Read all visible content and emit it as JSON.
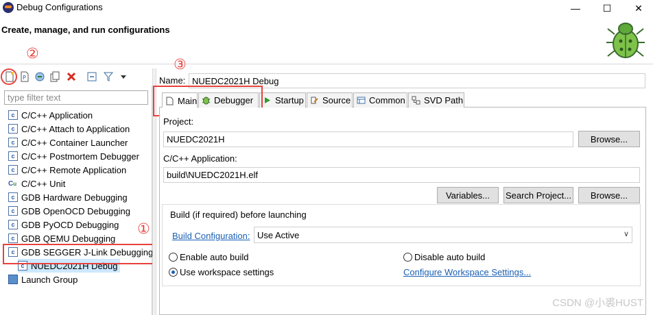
{
  "window": {
    "title": "Debug Configurations",
    "minimize": "—",
    "maximize": "☐",
    "close": "✕"
  },
  "header": {
    "title": "Create, manage, and run configurations",
    "logo_icon": "bug-icon"
  },
  "annotations": {
    "one": "①",
    "two": "②",
    "three": "③"
  },
  "toolbar": {
    "icons": [
      "new-configuration-icon",
      "new-prototype-icon",
      "export-icon",
      "duplicate-icon",
      "delete-icon",
      "collapse-all-icon",
      "filter-icon",
      "view-menu-icon"
    ]
  },
  "filter": {
    "placeholder": "type filter text"
  },
  "tree": {
    "items": [
      {
        "label": "C/C++ Application",
        "icon": "c-config-icon"
      },
      {
        "label": "C/C++ Attach to Application",
        "icon": "c-config-icon"
      },
      {
        "label": "C/C++ Container Launcher",
        "icon": "c-config-icon"
      },
      {
        "label": "C/C++ Postmortem Debugger",
        "icon": "c-config-icon"
      },
      {
        "label": "C/C++ Remote Application",
        "icon": "c-config-icon"
      },
      {
        "label": "C/C++ Unit",
        "icon": "c-unit-icon"
      },
      {
        "label": "GDB Hardware Debugging",
        "icon": "c-config-icon"
      },
      {
        "label": "GDB OpenOCD Debugging",
        "icon": "c-config-icon"
      },
      {
        "label": "GDB PyOCD Debugging",
        "icon": "c-config-icon"
      },
      {
        "label": "GDB QEMU Debugging",
        "icon": "c-config-icon"
      },
      {
        "label": "GDB SEGGER J-Link Debugging",
        "icon": "c-config-icon"
      },
      {
        "label": "NUEDC2021H Debug",
        "icon": "c-config-icon"
      },
      {
        "label": "Launch Group",
        "icon": "launch-group-icon"
      }
    ]
  },
  "name": {
    "label": "Name:",
    "value": "NUEDC2021H Debug"
  },
  "tabs": [
    {
      "label": "Main",
      "icon": "main-tab-icon"
    },
    {
      "label": "Debugger",
      "icon": "debugger-bug-icon"
    },
    {
      "label": "Startup",
      "icon": "startup-play-icon"
    },
    {
      "label": "Source",
      "icon": "source-icon"
    },
    {
      "label": "Common",
      "icon": "common-icon"
    },
    {
      "label": "SVD Path",
      "icon": "svd-path-icon"
    }
  ],
  "main": {
    "project_label": "Project:",
    "project_value": "NUEDC2021H",
    "browse_label": "Browse...",
    "app_label": "C/C++ Application:",
    "app_value": "build\\NUEDC2021H.elf",
    "variables_label": "Variables...",
    "search_project_label": "Search Project...",
    "browse2_label": "Browse...",
    "build_group_label": "Build (if required) before launching",
    "build_config_link": "Build Configuration:",
    "build_config_value": "Use Active",
    "enable_auto_build": "Enable auto build",
    "disable_auto_build": "Disable auto build",
    "use_workspace_settings": "Use workspace settings",
    "configure_workspace_link": "Configure Workspace Settings..."
  },
  "watermark": "CSDN @小裘HUST",
  "colors": {
    "annotation_red": "#e8413c",
    "link_blue": "#1a5fb4",
    "selection": "#cde8ff"
  }
}
